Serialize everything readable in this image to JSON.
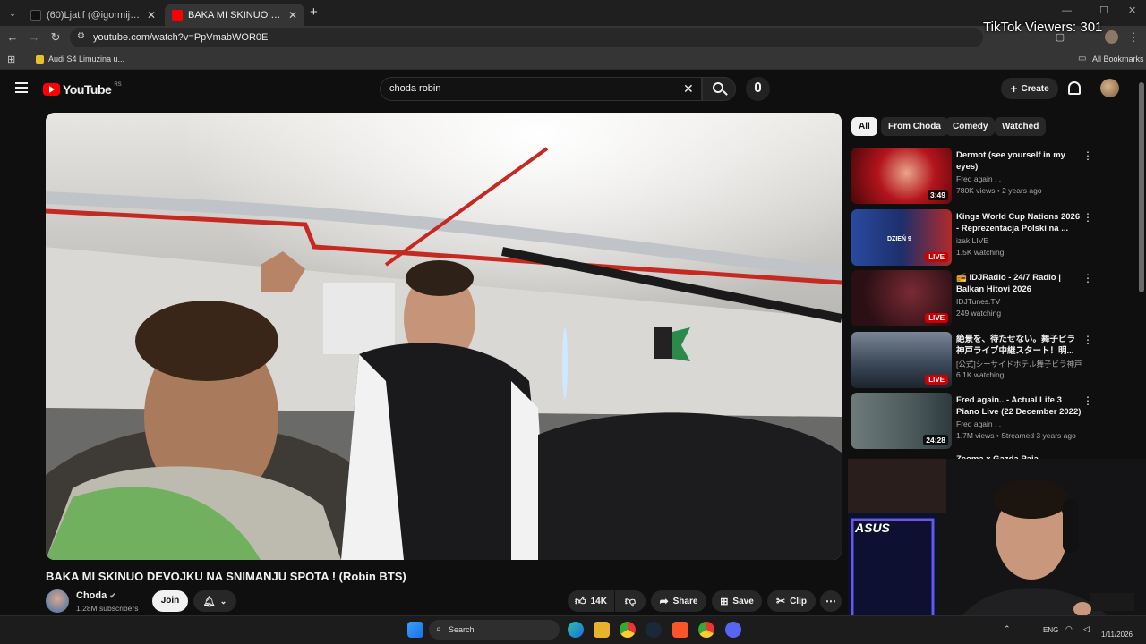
{
  "browser": {
    "tabs": [
      {
        "title": "(60)Ljatif (@igormijovic00) | TikTok",
        "active": false,
        "favicon_color": "#111111"
      },
      {
        "title": "BAKA MI SKINUO DEVOJKU NA SNIMANJU SPOTA ! (Robin BTS)",
        "active": true,
        "favicon_color": "#ff0000"
      }
    ],
    "url": "youtube.com/watch?v=PpVmabWOR0E",
    "bookmark": "Audi S4 Limuzina u...",
    "all_bookmarks": "All Bookmarks"
  },
  "overlay_text": "TikTok Viewers: 301",
  "youtube": {
    "logo_text": "YouTube",
    "country": "RS",
    "search_value": "choda robin",
    "create_label": "Create",
    "video_title": "BAKA MI SKINUO DEVOJKU NA SNIMANJU SPOTA ! (Robin BTS)",
    "channel_name": "Choda",
    "subscribers": "1.28M subscribers",
    "join_label": "Join",
    "actions": {
      "likes": "14K",
      "share": "Share",
      "save": "Save",
      "clip": "Clip"
    },
    "chips": [
      "All",
      "From Choda",
      "Comedy",
      "Watched"
    ],
    "recommendations": [
      {
        "title": "Dermot (see yourself in my eyes)",
        "channel": "Fred again . .",
        "meta": "780K views • 2 years ago",
        "duration": "3:49",
        "live": false,
        "thumb_color": "#b3141c"
      },
      {
        "title": "Kings World Cup Nations 2026 - Reprezentacja Polski na ...",
        "channel": "izak LIVE",
        "meta": "1.5K watching",
        "live": true,
        "live_label": "LIVE",
        "thumb_color": "#1d2f6b",
        "thumb_text": "DZIEŃ 9"
      },
      {
        "title": "📻 IDJRadio - 24/7 Radio | Balkan Hitovi 2026",
        "channel": "IDJTunes.TV",
        "meta": "249 watching",
        "live": true,
        "live_label": "LIVE",
        "thumb_color": "#2a0f14"
      },
      {
        "title": "絶景を、待たせない。舞子ビラ神戸ライブ中継スタート！明...",
        "channel": "[公式]シーサイドホテル舞子ビラ神戸",
        "meta": "6.1K watching",
        "live": true,
        "live_label": "LIVE",
        "thumb_color": "#3d4a5a"
      },
      {
        "title": "Fred again.. - Actual Life 3 Piano Live (22 December 2022)",
        "channel": "Fred again . .",
        "meta": "1.7M views • Streamed 3 years ago",
        "duration": "24:28",
        "live": false,
        "thumb_color": "#4c5a5c"
      },
      {
        "title": "Zeoma x Gazda Paja",
        "channel": "",
        "meta": "",
        "live": false,
        "thumb_color": "#222"
      }
    ]
  },
  "taskbar": {
    "search_label": "Search",
    "lang": "ENG",
    "date": "1/11/2026"
  }
}
